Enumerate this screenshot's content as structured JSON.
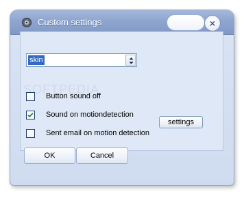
{
  "window": {
    "title": "Custom settings",
    "accent": "#8ea5cf",
    "background": "#d9e4f4"
  },
  "skin": {
    "value": "skin"
  },
  "options": [
    {
      "label": "Button sound off",
      "checked": false
    },
    {
      "label": "Sound on motiondetection",
      "checked": true
    },
    {
      "label": "Sent email on motion detection",
      "checked": false
    }
  ],
  "settings_button": {
    "label": "settings"
  },
  "buttons": {
    "ok_label": "OK",
    "cancel_label": "Cancel"
  },
  "watermark": {
    "text": "SOFTPEDIA"
  }
}
